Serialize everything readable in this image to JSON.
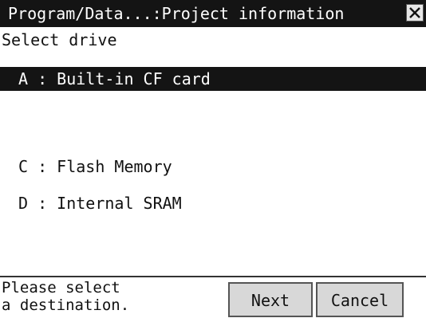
{
  "window": {
    "title": "Program/Data...:Project information",
    "close_icon": "close-icon"
  },
  "prompt": "Select drive",
  "drives": [
    {
      "label": "A : Built-in CF card",
      "selected": true
    },
    {
      "label": "C : Flash Memory",
      "selected": false
    },
    {
      "label": "D : Internal SRAM",
      "selected": false
    }
  ],
  "footer": {
    "message": "Please select\na destination.",
    "next_label": "Next",
    "cancel_label": "Cancel"
  },
  "colors": {
    "selection_bg": "#141414",
    "titlebar_bg": "#141414",
    "button_bg": "#d8d8d8"
  }
}
